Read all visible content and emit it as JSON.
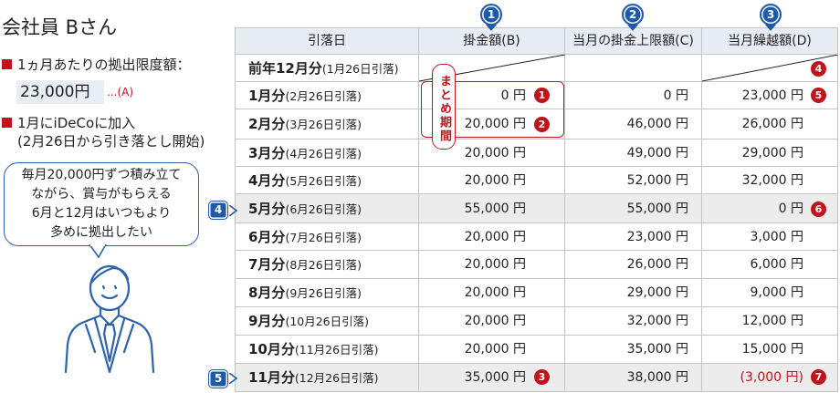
{
  "left_panel": {
    "person": "会社員 Bさん",
    "limit_label": "1ヵ月あたりの拠出限度額：",
    "limit_amount": "23,000円",
    "limit_ref": "...(A)",
    "join_line1": "1月にiDeCoに加入",
    "join_line2": "(2月26日から引き落とし開始)",
    "speech": [
      "毎月20,000円ずつ積み立て",
      "ながら、賞与がもらえる",
      "6月と12月はいつもより",
      "多めに拠出したい"
    ]
  },
  "table": {
    "headers": [
      "引落日",
      "掛金額(B)",
      "当月の掛金上限額(C)",
      "当月繰越額(D)"
    ],
    "header_markers": [
      "1",
      "2",
      "3"
    ],
    "rows": [
      {
        "month": "前年12月分",
        "date": "(1月26日引落)",
        "b": "",
        "c": "",
        "d": ""
      },
      {
        "month": "1月分",
        "date": "(2月26日引落)",
        "b": "0 円",
        "c": "0 円",
        "d": "23,000 円"
      },
      {
        "month": "2月分",
        "date": "(3月26日引落)",
        "b": "20,000 円",
        "c": "46,000 円",
        "d": "26,000 円"
      },
      {
        "month": "3月分",
        "date": "(4月26日引落)",
        "b": "20,000 円",
        "c": "49,000 円",
        "d": "29,000 円"
      },
      {
        "month": "4月分",
        "date": "(5月26日引落)",
        "b": "20,000 円",
        "c": "52,000 円",
        "d": "32,000 円"
      },
      {
        "month": "5月分",
        "date": "(6月26日引落)",
        "b": "55,000 円",
        "c": "55,000 円",
        "d": "0 円"
      },
      {
        "month": "6月分",
        "date": "(7月26日引落)",
        "b": "20,000 円",
        "c": "23,000 円",
        "d": "3,000 円"
      },
      {
        "month": "7月分",
        "date": "(8月26日引落)",
        "b": "20,000 円",
        "c": "26,000 円",
        "d": "6,000 円"
      },
      {
        "month": "8月分",
        "date": "(9月26日引落)",
        "b": "20,000 円",
        "c": "29,000 円",
        "d": "9,000 円"
      },
      {
        "month": "9月分",
        "date": "(10月26日引落)",
        "b": "20,000 円",
        "c": "32,000 円",
        "d": "12,000 円"
      },
      {
        "month": "10月分",
        "date": "(11月26日引落)",
        "b": "20,000 円",
        "c": "35,000 円",
        "d": "15,000 円"
      },
      {
        "month": "11月分",
        "date": "(12月26日引落)",
        "b": "35,000 円",
        "c": "38,000 円",
        "d": "(3,000 円)"
      }
    ],
    "matome_label": "まとめ期間",
    "row_markers": {
      "may": "4",
      "nov": "5"
    },
    "red_markers": [
      "4",
      "1",
      "5",
      "2",
      "6",
      "3",
      "7"
    ]
  },
  "colors": {
    "accent_red": "#c0141c",
    "accent_blue": "#1f5aa8",
    "header_bg": "#e8edf4"
  }
}
